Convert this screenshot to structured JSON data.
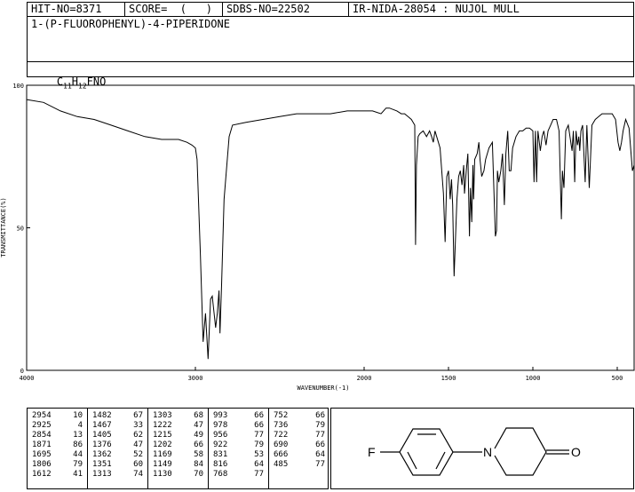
{
  "header": {
    "hit_no": "HIT-NO=8371",
    "score": "SCORE=  (   )",
    "sdbs_no": "SDBS-NO=22502",
    "ir_info": "IR-NIDA-28054 : NUJOL MULL",
    "compound_name": "1-(P-FLUOROPHENYL)-4-PIPERIDONE",
    "formula_c": "C",
    "formula_c_sub": "11",
    "formula_h": "H",
    "formula_h_sub": "12",
    "formula_rest": "FNO"
  },
  "chart_data": {
    "type": "line",
    "xlabel": "WAVENUMBER(-1)",
    "ylabel": "TRANSMITTANCE(%)",
    "xlim": [
      4000,
      400
    ],
    "ylim": [
      0,
      100
    ],
    "x_ticks": [
      4000,
      3000,
      2000,
      1500,
      1000,
      500
    ],
    "y_ticks": [
      0,
      50,
      100
    ],
    "grid": false,
    "series": [
      {
        "x": [
          4000,
          3900,
          3800,
          3700,
          3600,
          3500,
          3400,
          3300,
          3200,
          3100,
          3050,
          3020,
          3000,
          2990,
          2970,
          2954,
          2940,
          2925,
          2910,
          2900,
          2880,
          2870,
          2860,
          2854,
          2845,
          2830,
          2800,
          2780,
          2700,
          2600,
          2500,
          2400,
          2300,
          2200,
          2100,
          2000,
          1950,
          1900,
          1870,
          1850,
          1806,
          1780,
          1760,
          1740,
          1720,
          1700,
          1695,
          1690,
          1680,
          1670,
          1650,
          1630,
          1612,
          1600,
          1590,
          1580,
          1570,
          1560,
          1550,
          1540,
          1530,
          1520,
          1510,
          1500,
          1490,
          1482,
          1475,
          1467,
          1460,
          1450,
          1440,
          1430,
          1420,
          1410,
          1405,
          1395,
          1385,
          1376,
          1370,
          1362,
          1355,
          1351,
          1345,
          1330,
          1320,
          1313,
          1303,
          1290,
          1280,
          1260,
          1240,
          1222,
          1215,
          1210,
          1202,
          1190,
          1180,
          1169,
          1160,
          1149,
          1140,
          1130,
          1120,
          1110,
          1100,
          1080,
          1060,
          1040,
          1020,
          1000,
          993,
          985,
          978,
          970,
          956,
          945,
          935,
          922,
          910,
          895,
          880,
          860,
          845,
          831,
          825,
          816,
          805,
          790,
          768,
          760,
          752,
          744,
          736,
          728,
          722,
          715,
          705,
          690,
          680,
          666,
          650,
          630,
          610,
          590,
          570,
          550,
          530,
          510,
          495,
          485,
          475,
          465,
          450,
          430,
          410,
          400
        ],
        "y": [
          95,
          94,
          91,
          89,
          88,
          86,
          84,
          82,
          81,
          81,
          80,
          79,
          78,
          74,
          40,
          10,
          20,
          4,
          25,
          26,
          15,
          20,
          28,
          13,
          30,
          60,
          82,
          86,
          87,
          88,
          89,
          90,
          90,
          90,
          91,
          91,
          91,
          90,
          92,
          92,
          91,
          90,
          90,
          89,
          88,
          86,
          44,
          72,
          82,
          83,
          84,
          82,
          84,
          82,
          80,
          84,
          82,
          80,
          78,
          70,
          62,
          45,
          68,
          70,
          60,
          67,
          58,
          33,
          44,
          60,
          68,
          70,
          65,
          72,
          62,
          70,
          76,
          47,
          64,
          52,
          72,
          60,
          74,
          76,
          80,
          74,
          68,
          70,
          74,
          78,
          80,
          47,
          49,
          70,
          66,
          70,
          76,
          58,
          76,
          84,
          70,
          70,
          78,
          80,
          82,
          84,
          84,
          85,
          85,
          84,
          66,
          84,
          66,
          84,
          77,
          82,
          84,
          79,
          84,
          86,
          88,
          88,
          84,
          53,
          70,
          64,
          84,
          86,
          77,
          84,
          66,
          84,
          79,
          82,
          77,
          84,
          86,
          66,
          86,
          64,
          86,
          88,
          89,
          90,
          90,
          90,
          90,
          88,
          80,
          77,
          80,
          84,
          88,
          85,
          70,
          72
        ]
      }
    ]
  },
  "peak_table": [
    [
      [
        "2954",
        "10"
      ],
      [
        "2925",
        "4"
      ],
      [
        "2854",
        "13"
      ],
      [
        "1871",
        "86"
      ],
      [
        "1695",
        "44"
      ],
      [
        "1806",
        "79"
      ],
      [
        "1612",
        "41"
      ]
    ],
    [
      [
        "1482",
        "67"
      ],
      [
        "1467",
        "33"
      ],
      [
        "1405",
        "62"
      ],
      [
        "1376",
        "47"
      ],
      [
        "1362",
        "52"
      ],
      [
        "1351",
        "60"
      ],
      [
        "1313",
        "74"
      ]
    ],
    [
      [
        "1303",
        "68"
      ],
      [
        "1222",
        "47"
      ],
      [
        "1215",
        "49"
      ],
      [
        "1202",
        "66"
      ],
      [
        "1169",
        "58"
      ],
      [
        "1149",
        "84"
      ],
      [
        "1130",
        "70"
      ]
    ],
    [
      [
        "993",
        "66"
      ],
      [
        "978",
        "66"
      ],
      [
        "956",
        "77"
      ],
      [
        "922",
        "79"
      ],
      [
        "831",
        "53"
      ],
      [
        "816",
        "64"
      ],
      [
        "768",
        "77"
      ]
    ],
    [
      [
        "752",
        "66"
      ],
      [
        "736",
        "79"
      ],
      [
        "722",
        "77"
      ],
      [
        "690",
        "66"
      ],
      [
        "666",
        "64"
      ],
      [
        "485",
        "77"
      ]
    ]
  ],
  "structure": {
    "atom_f": "F",
    "atom_n": "N",
    "atom_o": "O"
  }
}
